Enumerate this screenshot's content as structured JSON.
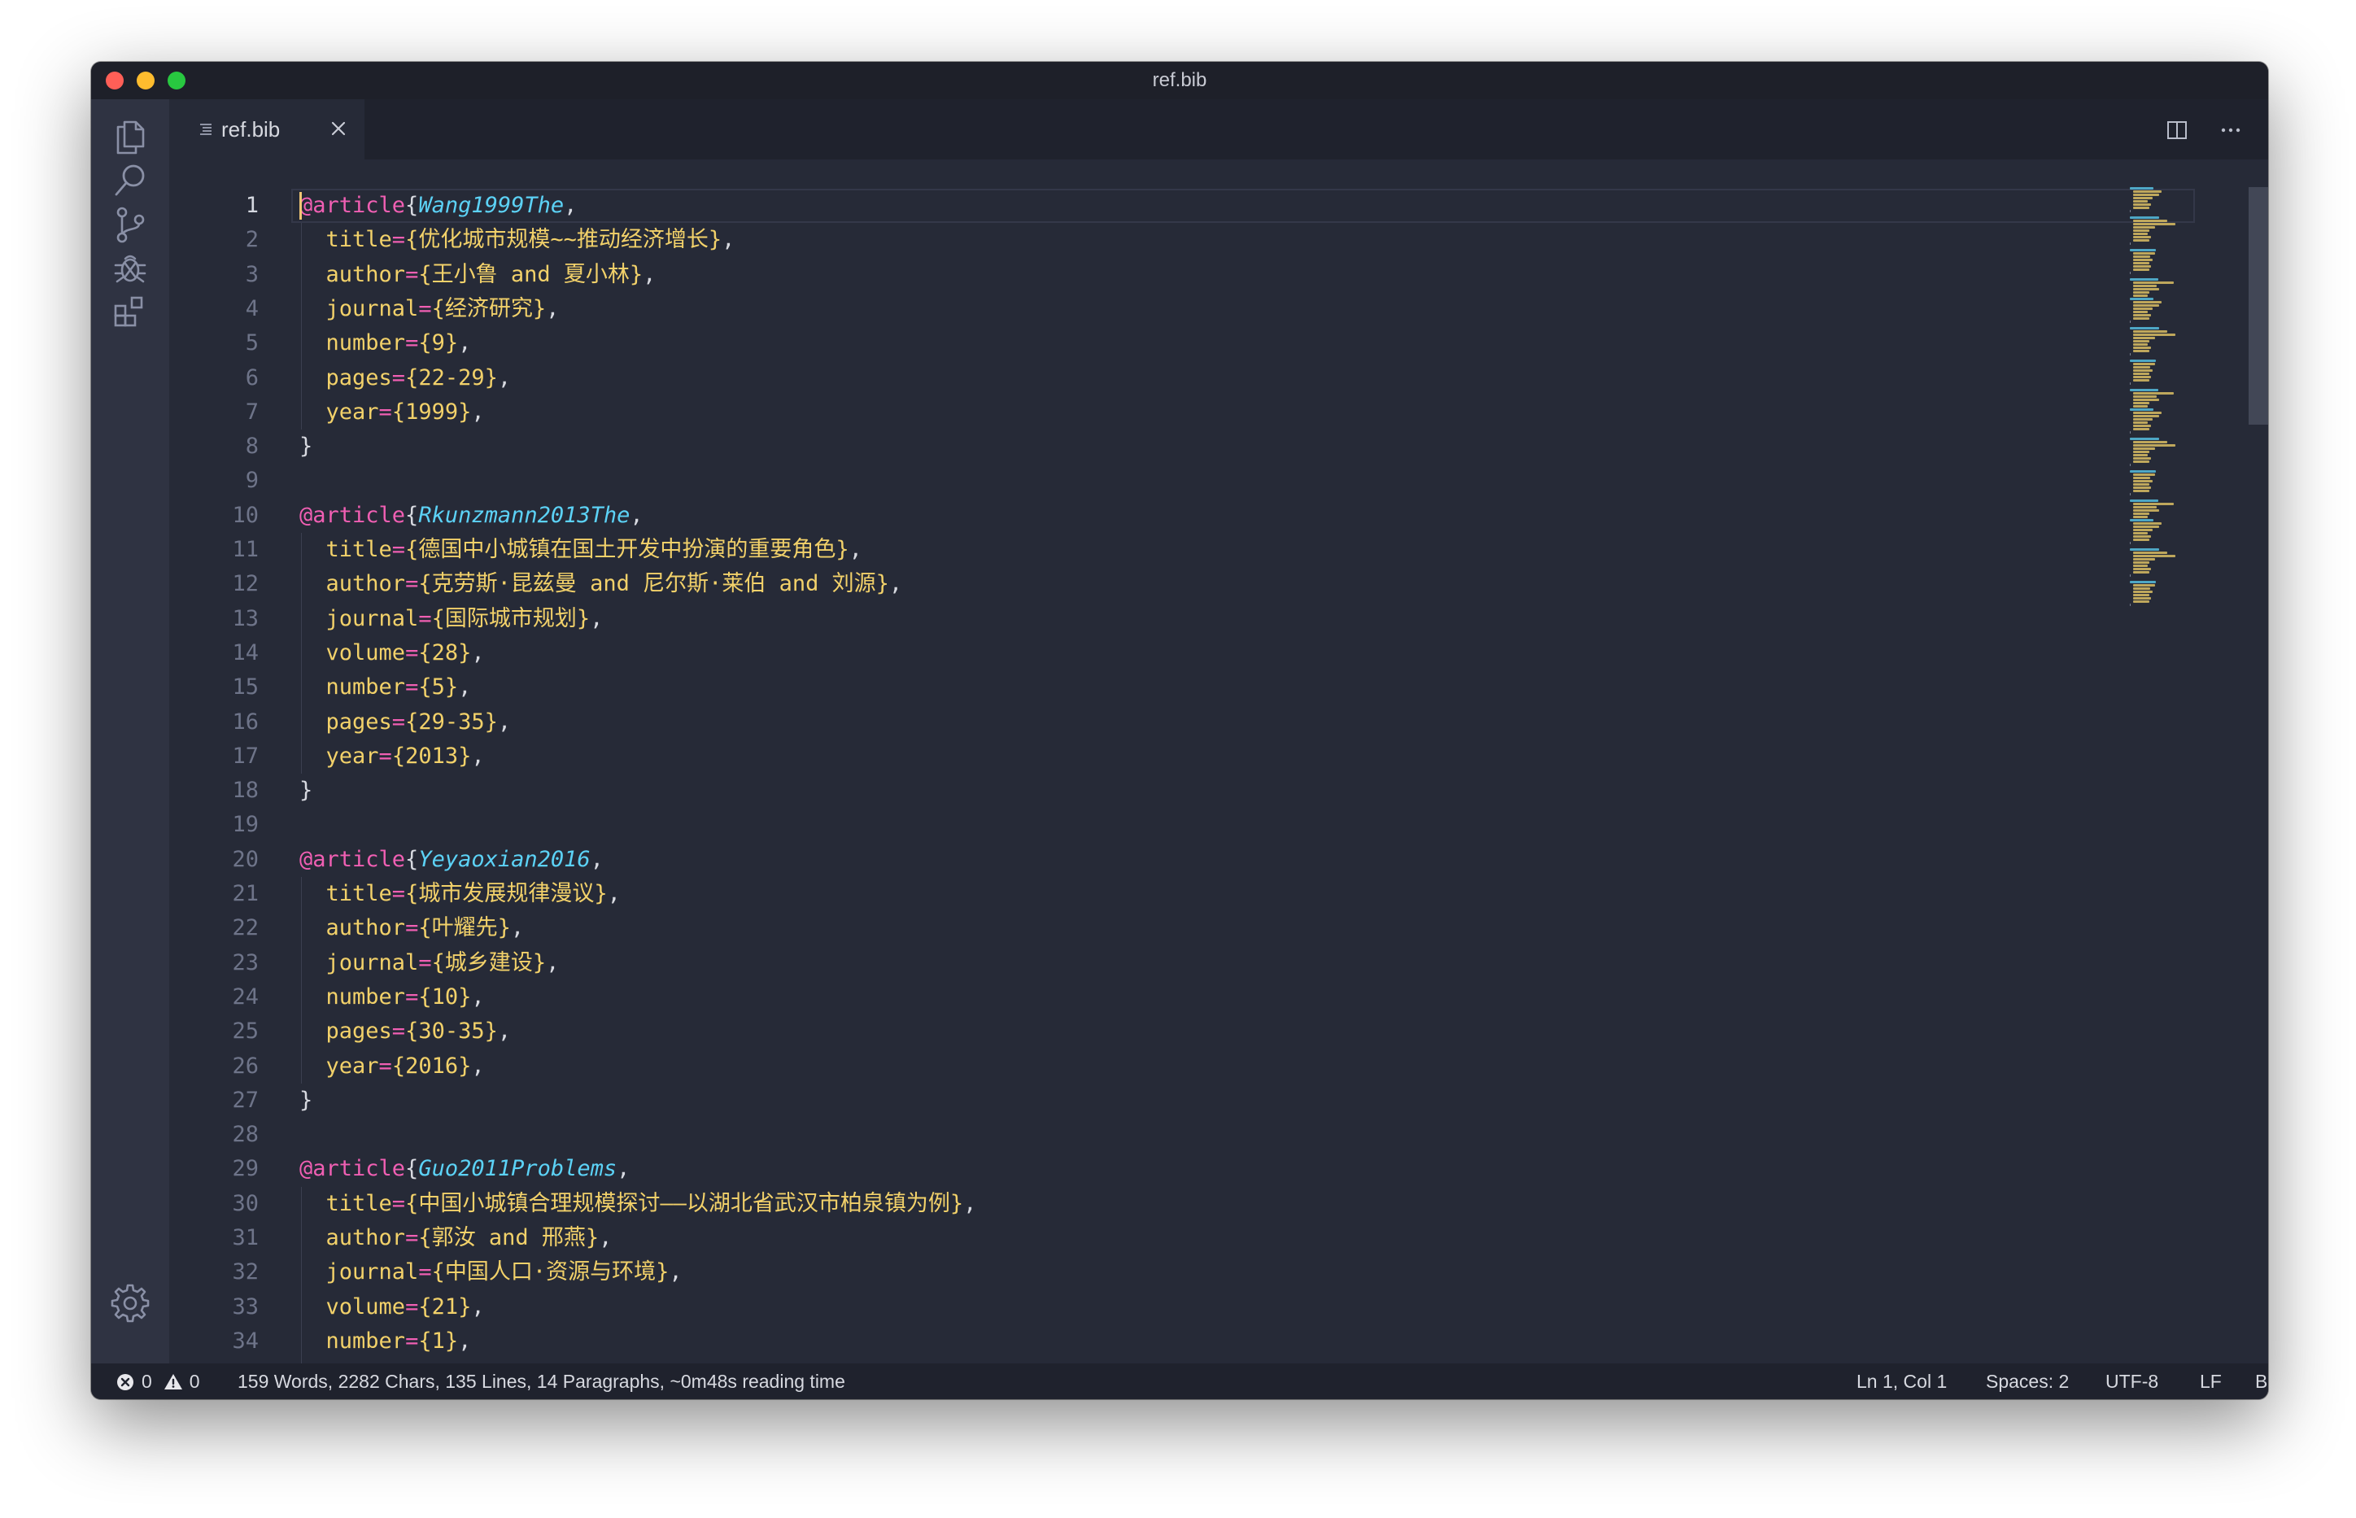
{
  "window": {
    "title": "ref.bib"
  },
  "tab": {
    "label": "ref.bib"
  },
  "colors": {
    "keyword": "#f05fb3",
    "citekey": "#5cd2f6",
    "field": "#f2d16a",
    "background": "#262a37"
  },
  "activity_bar": {
    "icons": [
      "explorer-icon",
      "search-icon",
      "source-control-icon",
      "debug-icon",
      "extensions-icon",
      "settings-gear-icon"
    ]
  },
  "editor": {
    "visible_first_line": 1,
    "lines": [
      "@article{Wang1999The,",
      "  title={优化城市规模~~推动经济增长},",
      "  author={王小鲁 and 夏小林},",
      "  journal={经济研究},",
      "  number={9},",
      "  pages={22-29},",
      "  year={1999},",
      "}",
      "",
      "@article{Rkunzmann2013The,",
      "  title={德国中小城镇在国土开发中扮演的重要角色},",
      "  author={克劳斯·昆兹曼 and 尼尔斯·莱伯 and 刘源},",
      "  journal={国际城市规划},",
      "  volume={28},",
      "  number={5},",
      "  pages={29-35},",
      "  year={2013},",
      "}",
      "",
      "@article{Yeyaoxian2016,",
      "  title={城市发展规律漫议},",
      "  author={叶耀先},",
      "  journal={城乡建设},",
      "  number={10},",
      "  pages={30-35},",
      "  year={2016},",
      "}",
      "",
      "@article{Guo2011Problems,",
      "  title={中国小城镇合理规模探讨——以湖北省武汉市柏泉镇为例},",
      "  author={郭汝 and 邢燕},",
      "  journal={中国人口·资源与环境},",
      "  volume={21},",
      "  number={1},"
    ]
  },
  "statusbar": {
    "errors": "0",
    "warnings": "0",
    "stats": "159 Words, 2282 Chars, 135 Lines, 14 Paragraphs, ~0m48s reading time",
    "position": "Ln 1, Col 1",
    "spaces": "Spaces: 2",
    "encoding": "UTF-8",
    "eol": "LF",
    "language": "BibTeX"
  }
}
